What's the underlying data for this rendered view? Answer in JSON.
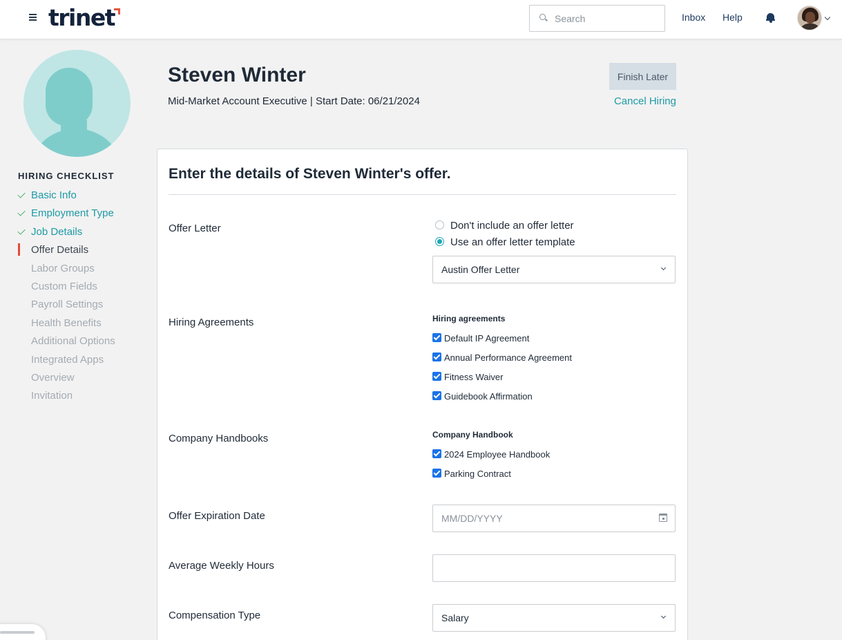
{
  "topbar": {
    "logo_text": "trinet",
    "search_placeholder": "Search",
    "inbox_label": "Inbox",
    "help_label": "Help",
    "icons": [
      "hamburger-menu-icon",
      "search-icon",
      "bell-icon",
      "chevron-down-icon"
    ]
  },
  "employee": {
    "name": "Steven Winter",
    "subtitle": "Mid-Market Account Executive | Start Date: 06/21/2024"
  },
  "actions": {
    "finish_later": "Finish Later",
    "cancel_hiring": "Cancel Hiring"
  },
  "checklist": {
    "title": "HIRING CHECKLIST",
    "items": [
      {
        "label": "Basic Info",
        "status": "done"
      },
      {
        "label": "Employment Type",
        "status": "done"
      },
      {
        "label": "Job Details",
        "status": "done"
      },
      {
        "label": "Offer Details",
        "status": "current"
      },
      {
        "label": "Labor Groups",
        "status": "todo"
      },
      {
        "label": "Custom Fields",
        "status": "todo"
      },
      {
        "label": "Payroll Settings",
        "status": "todo"
      },
      {
        "label": "Health Benefits",
        "status": "todo"
      },
      {
        "label": "Additional Options",
        "status": "todo"
      },
      {
        "label": "Integrated Apps",
        "status": "todo"
      },
      {
        "label": "Overview",
        "status": "todo"
      },
      {
        "label": "Invitation",
        "status": "todo"
      }
    ]
  },
  "form": {
    "title": "Enter the details of Steven Winter's offer.",
    "offer_letter": {
      "label": "Offer Letter",
      "options": [
        {
          "label": "Don't include an offer letter",
          "selected": false
        },
        {
          "label": "Use an offer letter template",
          "selected": true
        }
      ],
      "template_value": "Austin Offer Letter"
    },
    "hiring_agreements": {
      "label": "Hiring Agreements",
      "group_title": "Hiring agreements",
      "items": [
        {
          "label": "Default IP Agreement",
          "checked": true
        },
        {
          "label": "Annual Performance Agreement",
          "checked": true
        },
        {
          "label": "Fitness Waiver",
          "checked": true
        },
        {
          "label": "Guidebook Affirmation",
          "checked": true
        }
      ]
    },
    "company_handbooks": {
      "label": "Company Handbooks",
      "group_title": "Company Handbook",
      "items": [
        {
          "label": "2024 Employee Handbook",
          "checked": true
        },
        {
          "label": "Parking Contract",
          "checked": true
        }
      ]
    },
    "offer_expiration": {
      "label": "Offer Expiration Date",
      "placeholder": "MM/DD/YYYY",
      "value": ""
    },
    "weekly_hours": {
      "label": "Average Weekly Hours",
      "placeholder": "",
      "value": ""
    },
    "compensation_type": {
      "label": "Compensation Type",
      "value": "Salary"
    }
  },
  "colors": {
    "accent": "#1e9aa6",
    "current_marker": "#e84a3c",
    "done_check": "#43b26b",
    "checkbox": "#1a73e8"
  }
}
